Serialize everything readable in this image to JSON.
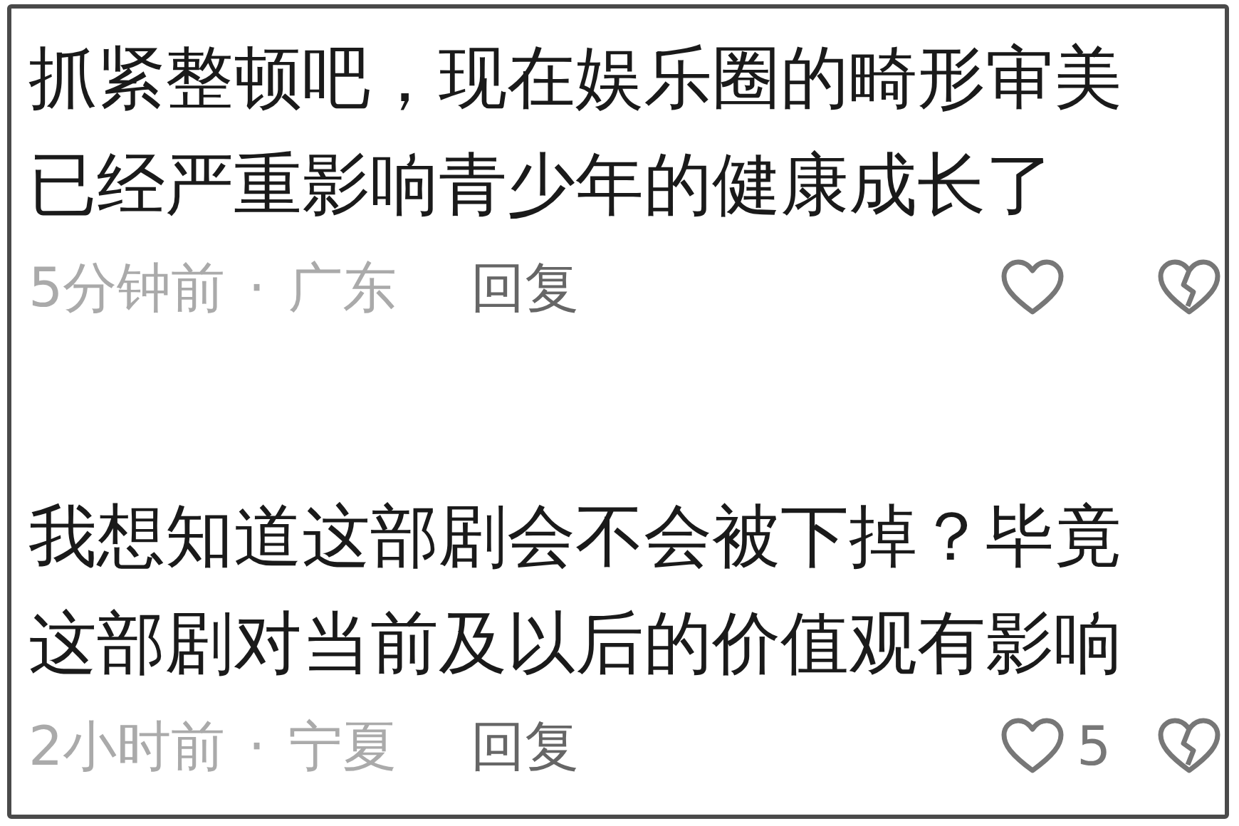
{
  "comments": [
    {
      "text": "抓紧整顿吧，现在娱乐圈的畸形审美已经严重影响青少年的健康成长了",
      "time": "5分钟前",
      "separator": "·",
      "location": "广东",
      "reply": "回复"
    },
    {
      "text": "我想知道这部剧会不会被下掉？毕竟这部剧对当前及以后的价值观有影响",
      "time": "2小时前",
      "separator": "·",
      "location": "宁夏",
      "reply": "回复",
      "likes": "5"
    }
  ]
}
